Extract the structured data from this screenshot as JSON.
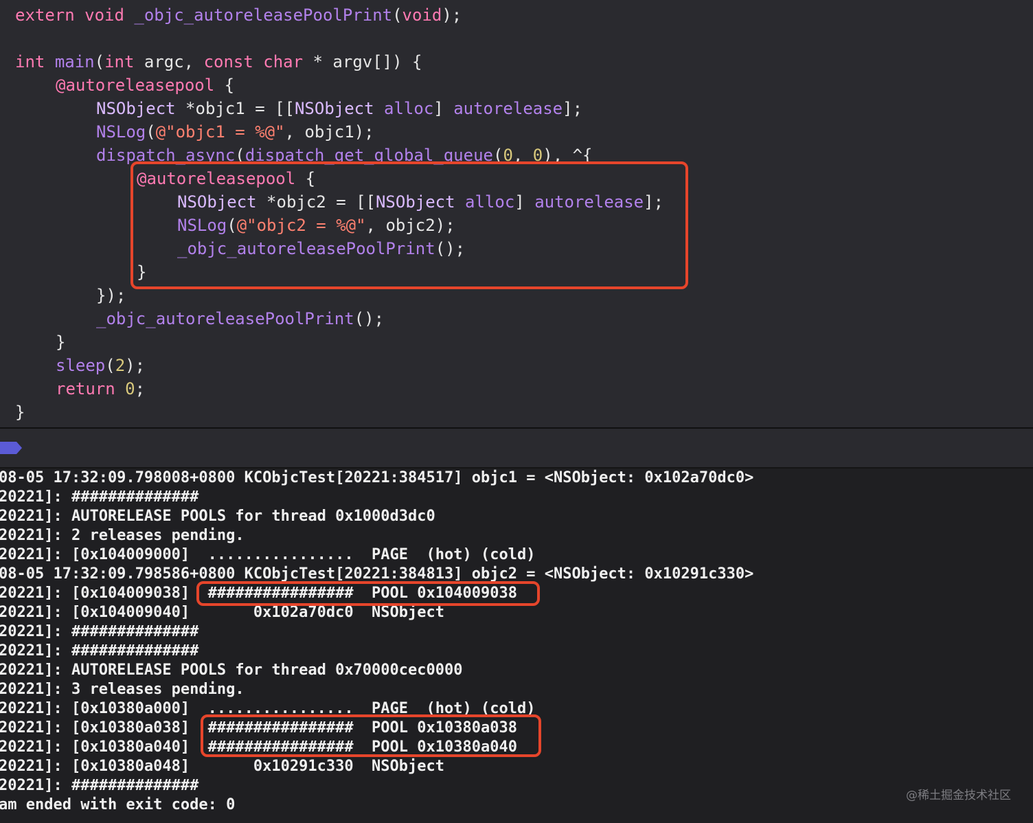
{
  "editor": {
    "lines": [
      {
        "segments": [
          {
            "t": "extern",
            "c": "kw"
          },
          {
            "t": " "
          },
          {
            "t": "void",
            "c": "kw"
          },
          {
            "t": " "
          },
          {
            "t": "_objc_autoreleasePoolPrint",
            "c": "fn"
          },
          {
            "t": "("
          },
          {
            "t": "void",
            "c": "kw"
          },
          {
            "t": ");"
          }
        ]
      },
      {
        "segments": []
      },
      {
        "segments": [
          {
            "t": "int",
            "c": "kw"
          },
          {
            "t": " "
          },
          {
            "t": "main",
            "c": "fn"
          },
          {
            "t": "("
          },
          {
            "t": "int",
            "c": "kw"
          },
          {
            "t": " argc, "
          },
          {
            "t": "const",
            "c": "kw"
          },
          {
            "t": " "
          },
          {
            "t": "char",
            "c": "kw"
          },
          {
            "t": " * argv[]) {"
          }
        ]
      },
      {
        "segments": [
          {
            "t": "@autoreleasepool",
            "c": "kw"
          },
          {
            "t": " {"
          }
        ]
      },
      {
        "segments": [
          {
            "t": "NSObject",
            "c": "cls"
          },
          {
            "t": " *objc1 = [["
          },
          {
            "t": "NSObject",
            "c": "cls"
          },
          {
            "t": " "
          },
          {
            "t": "alloc",
            "c": "fn"
          },
          {
            "t": "] "
          },
          {
            "t": "autorelease",
            "c": "fn"
          },
          {
            "t": "];"
          }
        ]
      },
      {
        "segments": [
          {
            "t": "NSLog",
            "c": "fn"
          },
          {
            "t": "("
          },
          {
            "t": "@\"objc1 = %@\"",
            "c": "str"
          },
          {
            "t": ", objc1);"
          }
        ]
      },
      {
        "segments": [
          {
            "t": "dispatch_async",
            "c": "fn"
          },
          {
            "t": "("
          },
          {
            "t": "dispatch_get_global_queue",
            "c": "fn"
          },
          {
            "t": "("
          },
          {
            "t": "0",
            "c": "num"
          },
          {
            "t": ", "
          },
          {
            "t": "0",
            "c": "num"
          },
          {
            "t": "), ^{"
          }
        ]
      },
      {
        "segments": [
          {
            "t": "@autoreleasepool",
            "c": "kw"
          },
          {
            "t": " {"
          }
        ]
      },
      {
        "segments": [
          {
            "t": "NSObject",
            "c": "cls"
          },
          {
            "t": " *objc2 = [["
          },
          {
            "t": "NSObject",
            "c": "cls"
          },
          {
            "t": " "
          },
          {
            "t": "alloc",
            "c": "fn"
          },
          {
            "t": "] "
          },
          {
            "t": "autorelease",
            "c": "fn"
          },
          {
            "t": "];"
          }
        ]
      },
      {
        "segments": [
          {
            "t": "NSLog",
            "c": "fn"
          },
          {
            "t": "("
          },
          {
            "t": "@\"objc2 = %@\"",
            "c": "str"
          },
          {
            "t": ", objc2);"
          }
        ]
      },
      {
        "segments": [
          {
            "t": "_objc_autoreleasePoolPrint",
            "c": "fn"
          },
          {
            "t": "();"
          }
        ]
      },
      {
        "segments": [
          {
            "t": "}"
          }
        ]
      },
      {
        "segments": [
          {
            "t": "});"
          }
        ]
      },
      {
        "segments": [
          {
            "t": "_objc_autoreleasePoolPrint",
            "c": "fn"
          },
          {
            "t": "();"
          }
        ]
      },
      {
        "segments": [
          {
            "t": "}"
          }
        ]
      },
      {
        "segments": [
          {
            "t": "sleep",
            "c": "fn"
          },
          {
            "t": "("
          },
          {
            "t": "2",
            "c": "num"
          },
          {
            "t": ");"
          }
        ]
      },
      {
        "segments": [
          {
            "t": "return",
            "c": "kw"
          },
          {
            "t": " "
          },
          {
            "t": "0",
            "c": "num"
          },
          {
            "t": ";"
          }
        ]
      },
      {
        "segments": [
          {
            "t": "}"
          }
        ]
      }
    ]
  },
  "console": {
    "lines": [
      "08-05 17:32:09.798008+0800 KCObjcTest[20221:384517] objc1 = <NSObject: 0x102a70dc0>",
      "20221]: ##############",
      "20221]: AUTORELEASE POOLS for thread 0x1000d3dc0",
      "20221]: 2 releases pending.",
      "20221]: [0x104009000]  ................  PAGE  (hot) (cold)",
      "08-05 17:32:09.798586+0800 KCObjcTest[20221:384813] objc2 = <NSObject: 0x10291c330>",
      "20221]: [0x104009038]  ################  POOL 0x104009038",
      "20221]: [0x104009040]       0x102a70dc0  NSObject",
      "20221]: ##############",
      "20221]: ##############",
      "20221]: AUTORELEASE POOLS for thread 0x70000cec0000",
      "20221]: 3 releases pending.",
      "20221]: [0x10380a000]  ................  PAGE  (hot) (cold)",
      "20221]: [0x10380a038]  ################  POOL 0x10380a038",
      "20221]: [0x10380a040]  ################  POOL 0x10380a040",
      "20221]: [0x10380a048]       0x10291c330  NSObject",
      "20221]: ##############",
      "am ended with exit code: 0"
    ]
  },
  "watermark": "@稀土掘金技术社区",
  "colors": {
    "keyword": "#ff7ab2",
    "function": "#b281eb",
    "string": "#ff8170",
    "number": "#d9c97c",
    "highlight_box": "#e6452b",
    "breakpoint": "#5b5bd6"
  },
  "icons": [
    "breakpoint-icon"
  ]
}
